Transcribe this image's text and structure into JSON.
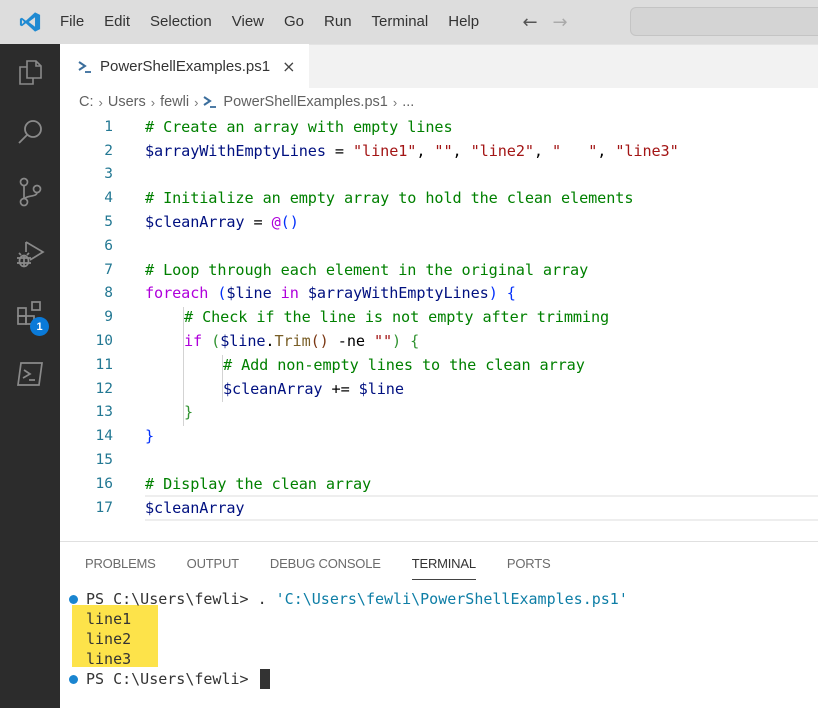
{
  "app": {
    "name": "Visual Studio Code",
    "accent_color": "#0a7ad8"
  },
  "menu": {
    "items": [
      "File",
      "Edit",
      "Selection",
      "View",
      "Go",
      "Run",
      "Terminal",
      "Help"
    ],
    "back_icon": "arrow-left-icon",
    "forward_icon": "arrow-right-icon"
  },
  "activity_bar": {
    "items": [
      {
        "name": "explorer",
        "icon": "files-icon"
      },
      {
        "name": "search",
        "icon": "search-icon"
      },
      {
        "name": "source-control",
        "icon": "source-control-icon"
      },
      {
        "name": "run-debug",
        "icon": "run-debug-icon"
      },
      {
        "name": "extensions",
        "icon": "extensions-icon",
        "badge": "1"
      },
      {
        "name": "terminal",
        "icon": "terminal-icon"
      }
    ]
  },
  "tabs": [
    {
      "title": "PowerShellExamples.ps1",
      "icon": "powershell-icon",
      "active": true,
      "close_label": "×"
    }
  ],
  "breadcrumb": {
    "items": [
      "C:",
      "Users",
      "fewli",
      "PowerShellExamples.ps1",
      "..."
    ],
    "separator": "›"
  },
  "editor": {
    "language": "PowerShell",
    "current_line": 17,
    "lines": [
      {
        "n": "1",
        "text": "# Create an array with empty lines"
      },
      {
        "n": "2",
        "text": "$arrayWithEmptyLines = \"line1\", \"\", \"line2\", \"   \", \"line3\""
      },
      {
        "n": "3",
        "text": ""
      },
      {
        "n": "4",
        "text": "# Initialize an empty array to hold the clean elements"
      },
      {
        "n": "5",
        "text": "$cleanArray = @()"
      },
      {
        "n": "6",
        "text": ""
      },
      {
        "n": "7",
        "text": "# Loop through each element in the original array"
      },
      {
        "n": "8",
        "text": "foreach ($line in $arrayWithEmptyLines) {"
      },
      {
        "n": "9",
        "text": "    # Check if the line is not empty after trimming"
      },
      {
        "n": "10",
        "text": "    if ($line.Trim() -ne \"\") {"
      },
      {
        "n": "11",
        "text": "        # Add non-empty lines to the clean array"
      },
      {
        "n": "12",
        "text": "        $cleanArray += $line"
      },
      {
        "n": "13",
        "text": "    }"
      },
      {
        "n": "14",
        "text": "}"
      },
      {
        "n": "15",
        "text": ""
      },
      {
        "n": "16",
        "text": "# Display the clean array"
      },
      {
        "n": "17",
        "text": "$cleanArray"
      }
    ],
    "tokens": {
      "l1": "# Create an array with empty lines",
      "l2_var": "$arrayWithEmptyLines",
      "l2_eq": " = ",
      "l2_s1": "\"line1\"",
      "l2_s2": "\"\"",
      "l2_s3": "\"line2\"",
      "l2_s4": "\"   \"",
      "l2_s5": "\"line3\"",
      "comma": ", ",
      "l4": "# Initialize an empty array to hold the clean elements",
      "l5_var": "$cleanArray",
      "l5_eq": " = ",
      "l5_at": "@",
      "l5_paren": "()",
      "l7": "# Loop through each element in the original array",
      "l8_kw": "foreach",
      "l8_open": " (",
      "l8_v1": "$line",
      "l8_in": " in ",
      "l8_v2": "$arrayWithEmptyLines",
      "l8_close": ")",
      "l8_brace": " {",
      "l9": "# Check if the line is not empty after trimming",
      "l10_kw": "if",
      "l10_open": " (",
      "l10_var": "$line",
      "l10_dot": ".",
      "l10_fn": "Trim",
      "l10_call": "()",
      "l10_op": " -ne ",
      "l10_str": "\"\"",
      "l10_close": ")",
      "l10_brace": " {",
      "l11": "# Add non-empty lines to the clean array",
      "l12_v1": "$cleanArray",
      "l12_op": " += ",
      "l12_v2": "$line",
      "l13": "}",
      "l14": "}",
      "l16": "# Display the clean array",
      "l17": "$cleanArray"
    }
  },
  "panel": {
    "tabs": [
      "PROBLEMS",
      "OUTPUT",
      "DEBUG CONSOLE",
      "TERMINAL",
      "PORTS"
    ],
    "active_tab": "TERMINAL"
  },
  "terminal": {
    "prompt": "PS C:\\Users\\fewli> ",
    "command_dot": ". ",
    "command_path": "'C:\\Users\\fewli\\PowerShellExamples.ps1'",
    "output": [
      "line1",
      "line2",
      "line3"
    ],
    "highlight_color": "#fde34a",
    "prompt2": "PS C:\\Users\\fewli> "
  }
}
